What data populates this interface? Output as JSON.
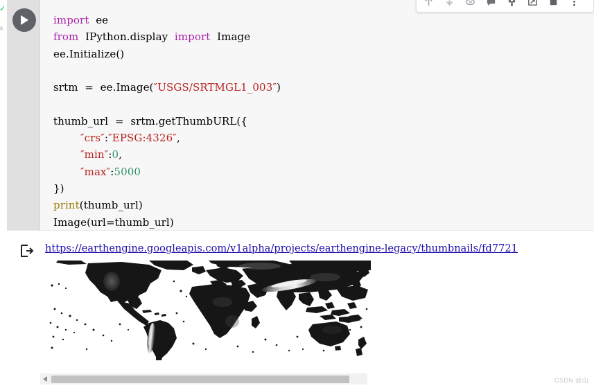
{
  "toolbar": {
    "buttons": [
      {
        "name": "move-cell-up-icon",
        "label": "Move cell up"
      },
      {
        "name": "move-cell-down-icon",
        "label": "Move cell down"
      },
      {
        "name": "link-to-cell-icon",
        "label": "Link to cell"
      },
      {
        "name": "add-comment-icon",
        "label": "Add a comment"
      },
      {
        "name": "cell-settings-icon",
        "label": "Cell settings"
      },
      {
        "name": "mirror-cell-tab-icon",
        "label": "Mirror cell in tab"
      },
      {
        "name": "delete-cell-icon",
        "label": "Delete cell"
      },
      {
        "name": "more-cell-actions-icon",
        "label": "More cell actions"
      }
    ]
  },
  "run_status": {
    "check_glyph": "✓",
    "letter": "s"
  },
  "code_cell": {
    "run_button_label": "Run cell",
    "lines": [
      [
        {
          "t": "import",
          "c": "kw"
        },
        {
          "t": "  ee",
          "c": "pl"
        }
      ],
      [
        {
          "t": "from",
          "c": "kw"
        },
        {
          "t": "  IPython.display  ",
          "c": "pl"
        },
        {
          "t": "import",
          "c": "kw"
        },
        {
          "t": "  Image",
          "c": "pl"
        }
      ],
      [
        {
          "t": "ee.Initialize()",
          "c": "pl"
        }
      ],
      [
        {
          "t": "",
          "c": "pl"
        }
      ],
      [
        {
          "t": "srtm  =  ee.Image(",
          "c": "pl"
        },
        {
          "t": "″USGS/SRTMGL1_003″",
          "c": "str"
        },
        {
          "t": ")",
          "c": "pl"
        }
      ],
      [
        {
          "t": "",
          "c": "pl"
        }
      ],
      [
        {
          "t": "thumb_url  =  srtm.getThumbURL({",
          "c": "pl"
        }
      ],
      [
        {
          "t": "        ",
          "c": "pl"
        },
        {
          "t": "″crs″",
          "c": "str"
        },
        {
          "t": ":",
          "c": "pl"
        },
        {
          "t": "″EPSG:4326″",
          "c": "str"
        },
        {
          "t": ",",
          "c": "pl"
        }
      ],
      [
        {
          "t": "        ",
          "c": "pl"
        },
        {
          "t": "″min″",
          "c": "str"
        },
        {
          "t": ":",
          "c": "pl"
        },
        {
          "t": "0",
          "c": "num"
        },
        {
          "t": ",",
          "c": "pl"
        }
      ],
      [
        {
          "t": "        ",
          "c": "pl"
        },
        {
          "t": "″max″",
          "c": "str"
        },
        {
          "t": ":",
          "c": "pl"
        },
        {
          "t": "5000",
          "c": "num"
        }
      ],
      [
        {
          "t": "})",
          "c": "pl"
        }
      ],
      [
        {
          "t": "print",
          "c": "bi"
        },
        {
          "t": "(thumb_url)",
          "c": "pl"
        }
      ],
      [
        {
          "t": "Image(url=thumb_url)",
          "c": "pl"
        }
      ]
    ]
  },
  "output_cell": {
    "url_text": "https://earthengine.googleapis.com/v1alpha/projects/earthengine-legacy/thumbnails/fd7721",
    "thumbnail_alt": "SRTM global elevation grayscale world map"
  },
  "scrollbar": {
    "left_arrow_glyph": "◀"
  },
  "watermark": {
    "text": "CSDN @山"
  },
  "colors": {
    "keyword": "#aa22aa",
    "string": "#ba2121",
    "number": "#2e9465",
    "builtin": "#9a7d0a",
    "link": "#1a0dab",
    "gutter": "#e0e0e0",
    "code_bg": "#f7f7f7",
    "run_button": "#5f6368",
    "status_check": "#00c853"
  }
}
